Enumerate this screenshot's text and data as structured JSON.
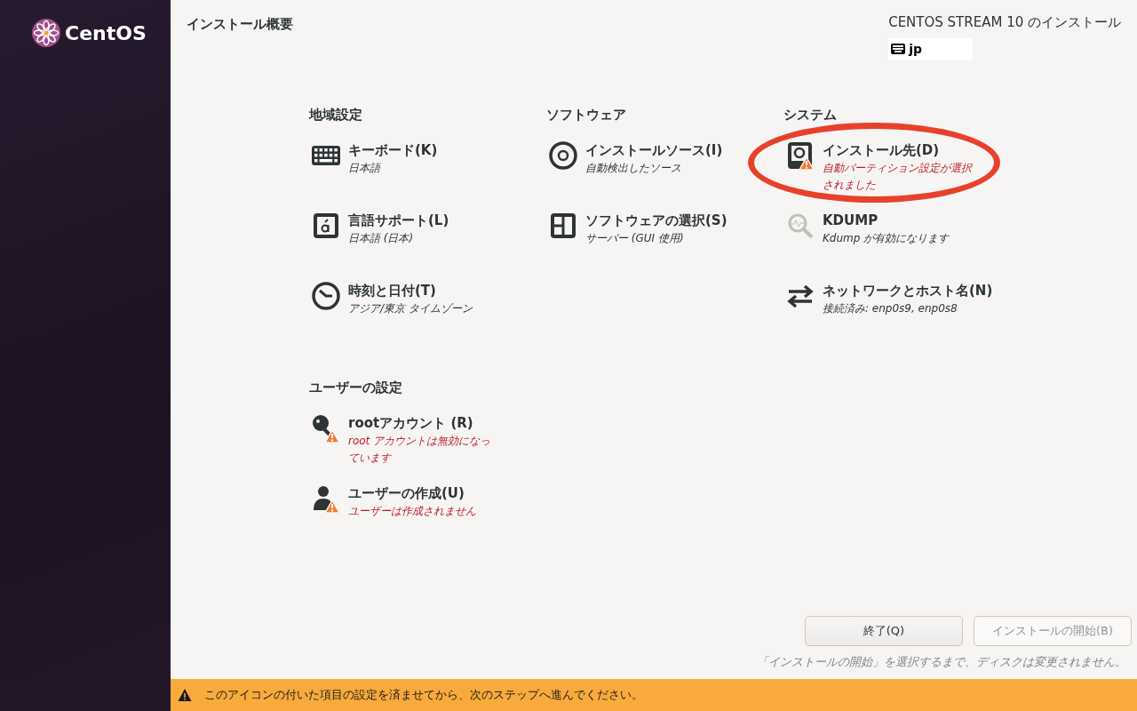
{
  "sidebar": {
    "logo_text": "CentOS"
  },
  "header": {
    "title": "インストール概要",
    "product": "CENTOS STREAM 10 のインストール",
    "keyboard_layout": "jp"
  },
  "categories": [
    {
      "title": "地域設定",
      "spokes": [
        {
          "kind": "keyboard",
          "title": "キーボード(K)",
          "status": "日本語",
          "warning": false,
          "highlighted": false
        },
        {
          "kind": "language",
          "title": "言語サポート(L)",
          "status": "日本語 (日本)",
          "warning": false,
          "highlighted": false
        },
        {
          "kind": "clock",
          "title": "時刻と日付(T)",
          "status": "アジア/東京 タイムゾーン",
          "warning": false,
          "highlighted": false
        }
      ]
    },
    {
      "title": "ソフトウェア",
      "spokes": [
        {
          "kind": "disc",
          "title": "インストールソース(I)",
          "status": "自動検出したソース",
          "warning": false,
          "highlighted": false
        },
        {
          "kind": "software",
          "title": "ソフトウェアの選択(S)",
          "status": "サーバー (GUI 使用)",
          "warning": false,
          "highlighted": false
        }
      ]
    },
    {
      "title": "システム",
      "spokes": [
        {
          "kind": "disk",
          "title": "インストール先(D)",
          "status": "自動パーティション設定が選択されました",
          "warning": true,
          "highlighted": true
        },
        {
          "kind": "kdump",
          "title": "KDUMP",
          "status": "Kdump が有効になります",
          "warning": false,
          "highlighted": false
        },
        {
          "kind": "network",
          "title": "ネットワークとホスト名(N)",
          "status": "接続済み: enp0s9, enp0s8",
          "warning": false,
          "highlighted": false
        }
      ]
    },
    {
      "title": "ユーザーの設定",
      "spokes": [
        {
          "kind": "root",
          "title": "rootアカウント (R)",
          "status": "root アカウントは無効になっています",
          "warning": true,
          "highlighted": false
        },
        {
          "kind": "user",
          "title": "ユーザーの作成(U)",
          "status": "ユーザーは作成されません",
          "warning": true,
          "highlighted": false
        }
      ]
    }
  ],
  "buttons": [
    {
      "label": "終了(Q)",
      "disabled": false
    },
    {
      "label": "インストールの開始(B)",
      "disabled": true
    }
  ],
  "note": "「インストールの開始」を選択するまで、ディスクは変更されません。",
  "warning_bar": {
    "text": "このアイコンの付いた項目の設定を済ませてから、次のステップへ進んでください。"
  }
}
